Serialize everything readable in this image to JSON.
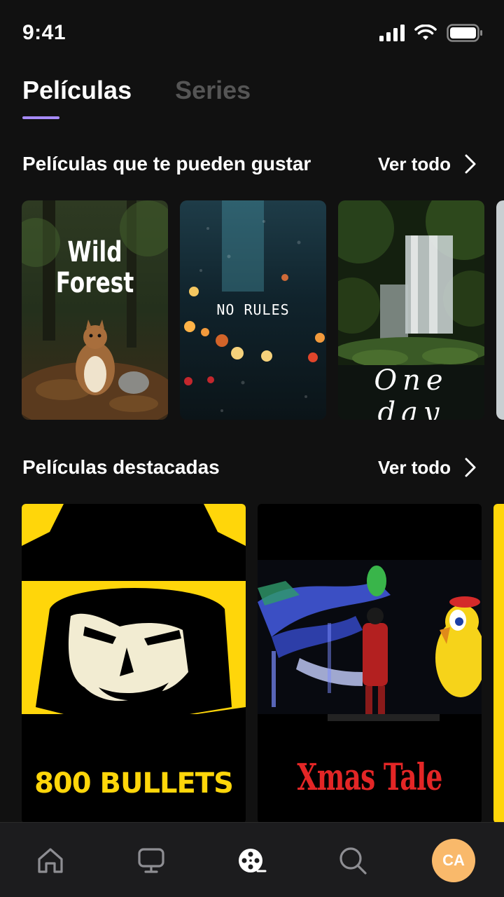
{
  "status_bar": {
    "time": "9:41"
  },
  "tabs": [
    {
      "label": "Películas",
      "active": true
    },
    {
      "label": "Series",
      "active": false
    }
  ],
  "sections": [
    {
      "title": "Películas que te pueden gustar",
      "see_all": "Ver todo",
      "items": [
        {
          "title_line1": "Wild",
          "title_line2": "Forest"
        },
        {
          "title": "NO RULES"
        },
        {
          "title": "One day"
        }
      ]
    },
    {
      "title": "Películas destacadas",
      "see_all": "Ver todo",
      "items": [
        {
          "title": "800 BULLETS"
        },
        {
          "title": "Xmas Tale"
        }
      ]
    }
  ],
  "bottom_nav": {
    "items": [
      "home-icon",
      "tv-icon",
      "film-reel-icon",
      "search-icon"
    ],
    "avatar_initials": "CA"
  },
  "colors": {
    "background": "#111111",
    "accent": "#a78bfa",
    "avatar": "#f9b96b",
    "poster_yellow": "#ffd60a",
    "xmas_red": "#e32626"
  }
}
